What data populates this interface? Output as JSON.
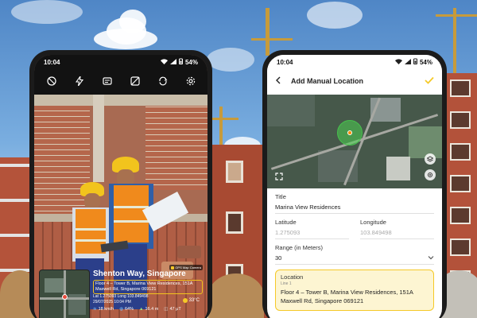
{
  "phone1": {
    "status": {
      "time": "10:04",
      "battery": "54%"
    },
    "toolbar_icons": [
      "no-flash-icon",
      "flash-icon",
      "template-icon",
      "map-off-icon",
      "switch-camera-icon",
      "settings-icon"
    ],
    "stamp": {
      "badge": "GPS Map Camera",
      "title": "Shenton Way, Singapore",
      "address": "Floor 4 – Tower B, Marina View Residences, 151A Maxwell Rd, Singapore 069121",
      "coords": "Lat 1.275093  Long 103.849498",
      "datetime": "29/07/2025 10:04 PM",
      "temperature": "33°C",
      "wind": "18 km/h",
      "humidity": "64%",
      "altitude": "16.4 m",
      "pressure": "47 μT"
    }
  },
  "phone2": {
    "status": {
      "time": "10:04",
      "battery": "54%"
    },
    "title": "Add Manual Location",
    "form": {
      "title_label": "Title",
      "title_value": "Marina View Residences",
      "latitude_label": "Latitude",
      "latitude_value": "1.275093",
      "longitude_label": "Longitude",
      "longitude_value": "103.849498",
      "range_label": "Range (in Meters)",
      "range_value": "30",
      "location_label": "Location",
      "location_sub": "Line 1",
      "location_value": "Floor 4 – Tower B, Marina View Residences, 151A Maxwell Rd, Singapore 069121"
    }
  },
  "colors": {
    "accent": "#F5C928",
    "geofence": "#4CD250"
  }
}
